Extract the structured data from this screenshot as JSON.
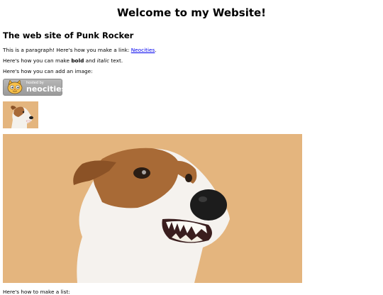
{
  "page": {
    "title": "Welcome to my Website!",
    "subtitle": "The web site of Punk Rocker",
    "para1_text": "This is a paragraph! Here's how you make a link: ",
    "para1_link": "Neocities",
    "para1_end": ".",
    "para2_start": "Here's how you can make ",
    "para2_bold": "bold",
    "para2_mid": " and ",
    "para2_italic": "italic",
    "para2_end": " text.",
    "para3": "Here's how you can add an image:",
    "badge_small": "hosted by",
    "badge_big": "neocities",
    "para4": "Here's how to make a list:"
  },
  "colors": {
    "link": "#0000ee",
    "dog_background": "#e4b57e"
  },
  "images": {
    "badge": "neocities-hosted-badge-cat-logo",
    "thumbnail": "jack-russell-terrier-dog-photo-small",
    "large": "jack-russell-terrier-dog-photo-large"
  }
}
